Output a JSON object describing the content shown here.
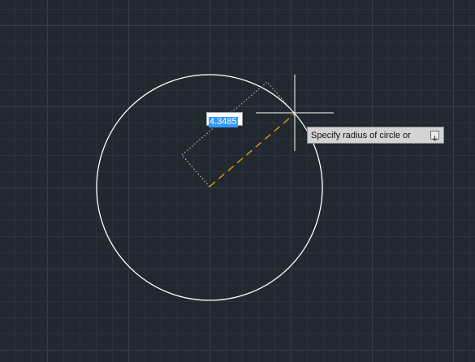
{
  "viewport": {
    "background_color": "#212830",
    "grid_minor_color": "#2b323b",
    "grid_major_color": "#343c46",
    "geometry_color": "#ffffff",
    "rubberband_color": "#f0a000"
  },
  "dynamic_input": {
    "value": "4.3485"
  },
  "command_prompt": {
    "text": "Specify radius of circle or",
    "options_icon": "chevron-down-icon"
  },
  "crosshair": {
    "icon": "crosshair-cursor-icon"
  }
}
